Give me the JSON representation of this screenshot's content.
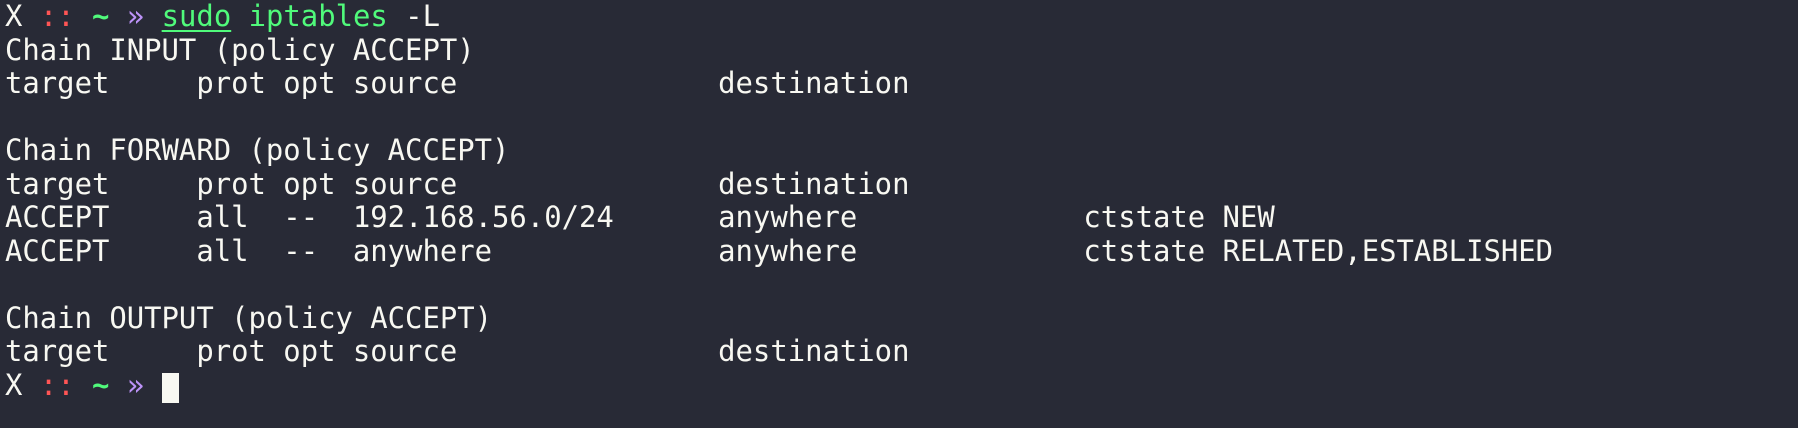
{
  "prompt": {
    "host": "X",
    "separator": "::",
    "cwd": "~",
    "arrow": "»",
    "sudo": "sudo",
    "command": "iptables -L",
    "command_options": "-L"
  },
  "output": [
    "Chain INPUT (policy ACCEPT)",
    "target     prot opt source               destination",
    "",
    "Chain FORWARD (policy ACCEPT)",
    "target     prot opt source               destination",
    "ACCEPT     all  --  192.168.56.0/24      anywhere             ctstate NEW",
    "ACCEPT     all  --  anywhere             anywhere             ctstate RELATED,ESTABLISHED",
    "",
    "Chain OUTPUT (policy ACCEPT)",
    "target     prot opt source               destination"
  ],
  "colors": {
    "background": "#282a36",
    "foreground": "#f8f8f2",
    "separator": "#ff5555",
    "cwd": "#50fa7b",
    "arrow": "#bd93f9",
    "command": "#50fa7b"
  }
}
